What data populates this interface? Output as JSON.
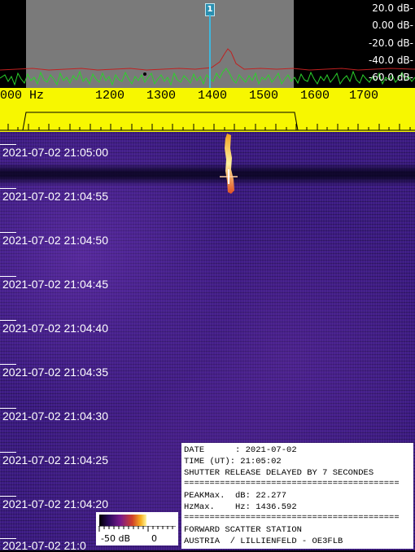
{
  "spectrum": {
    "db_labels": [
      "20.0 dB-",
      "0.00 dB-",
      "-20.0 dB-",
      "-40.0 dB-",
      "-60.0 dB-"
    ],
    "marker": "1",
    "colors": {
      "band": "#7a7a7a",
      "trace_green": "#2bd32b",
      "trace_red": "#c02020",
      "marker": "#3fb7dc"
    }
  },
  "scale": {
    "freq_labels": [
      "000 Hz",
      "1200",
      "1300",
      "1400",
      "1500",
      "1600",
      "1700"
    ]
  },
  "waterfall": {
    "timestamps": [
      "2021-07-02 21:05:00",
      "2021-07-02 21:04:55",
      "2021-07-02 21:04:50",
      "2021-07-02 21:04:45",
      "2021-07-02 21:04:40",
      "2021-07-02 21:04:35",
      "2021-07-02 21:04:30",
      "2021-07-02 21:04:25",
      "2021-07-02 21:04:20",
      "2021-07-02 21:0"
    ]
  },
  "colorbar": {
    "min_label": "-50 dB",
    "max_label": "0"
  },
  "info": {
    "date_line": "DATE      : 2021-07-02",
    "time_line": "TIME (UT): 21:05:02",
    "shutter_line": "SHUTTER RELEASE DELAYED BY 7 SECONDES",
    "sep": "==========================================",
    "peak_line": "PEAKMax.  dB: 22.277",
    "hz_line": "HzMax.    Hz: 1436.592",
    "station_line": "FORWARD SCATTER STATION",
    "location_line": "AUSTRIA  / LILLIENFELD - OE3FLB"
  }
}
